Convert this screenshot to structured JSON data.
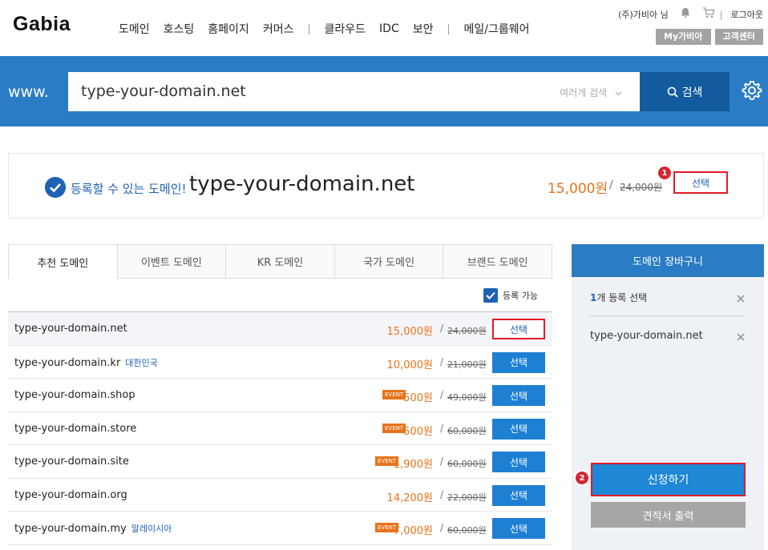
{
  "header": {
    "logo": "Gabia",
    "nav": [
      "도메인",
      "호스팅",
      "홈페이지",
      "커머스",
      "클라우드",
      "IDC",
      "보안",
      "메일/그룹웨어"
    ],
    "user": "(주)가비아 님",
    "logout": "로그아웃",
    "my_gabia": "My가비아",
    "support": "고객센터"
  },
  "search": {
    "prefix": "www.",
    "value": "type-your-domain.net",
    "multi_label": "여러개 검색",
    "button": "검색"
  },
  "result": {
    "available_text": "등록할 수 있는 도메인!",
    "domain": "type-your-domain.net",
    "price": "15,000원",
    "old_price": "24,000원",
    "select_label": "선택",
    "marker": "1"
  },
  "tabs": [
    "추천 도메인",
    "이벤트 도메인",
    "KR 도메인",
    "국가 도메인",
    "브랜드 도메인"
  ],
  "filter_label": "등록 가능",
  "domains": [
    {
      "name": "type-your-domain.net",
      "tag": "",
      "event": "",
      "price": "15,000원",
      "old": "24,000원",
      "select": "선택"
    },
    {
      "name": "type-your-domain.kr",
      "tag": "대한민국",
      "event": "",
      "price": "10,000원",
      "old": "21,000원",
      "select": "선택"
    },
    {
      "name": "type-your-domain.shop",
      "tag": "",
      "event": "EVENT",
      "price": "500원",
      "old": "49,000원",
      "select": "선택"
    },
    {
      "name": "type-your-domain.store",
      "tag": "",
      "event": "EVENT",
      "price": "500원",
      "old": "60,000원",
      "select": "선택"
    },
    {
      "name": "type-your-domain.site",
      "tag": "",
      "event": "EVENT",
      "price": "1,900원",
      "old": "60,000원",
      "select": "선택"
    },
    {
      "name": "type-your-domain.org",
      "tag": "",
      "event": "",
      "price": "14,200원",
      "old": "22,000원",
      "select": "선택"
    },
    {
      "name": "type-your-domain.my",
      "tag": "말레이시아",
      "event": "EVENT",
      "price": "7,000원",
      "old": "60,000원",
      "select": "선택"
    }
  ],
  "cart": {
    "title": "도메인 장바구니",
    "count_num": "1",
    "count_text": "개 등록 선택",
    "item": "type-your-domain.net",
    "apply": "신청하기",
    "quote": "견적서 출력",
    "marker": "2"
  },
  "colors": {
    "brand_blue": "#2a7cc4",
    "price_orange": "#e8731a",
    "highlight_red": "#e21b2a"
  }
}
